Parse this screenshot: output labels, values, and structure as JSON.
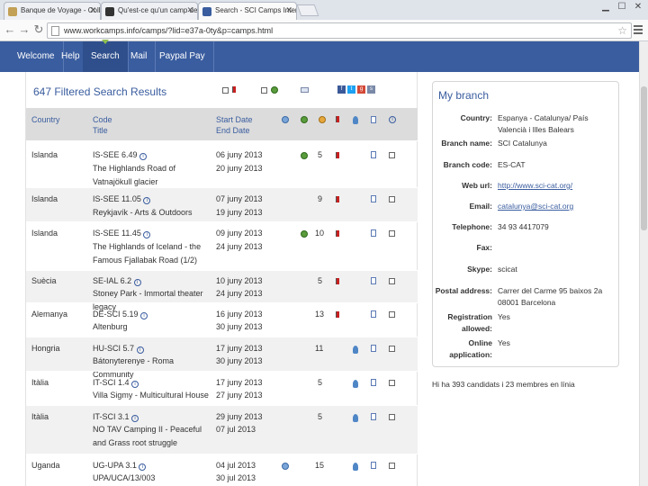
{
  "browser": {
    "tabs": [
      {
        "label": "Banque de Voyage - Collec",
        "active": false
      },
      {
        "label": "Qu'est-ce qu'un camp de volonta",
        "active": false
      },
      {
        "label": "Search - SCI Camps Internation",
        "active": true
      }
    ],
    "url": "www.workcamps.info/camps/?lid=e37a-0ty&p=camps.html"
  },
  "nav": [
    {
      "label": "Welcome"
    },
    {
      "label": "Help"
    },
    {
      "label": "Search"
    },
    {
      "label": "Mail"
    },
    {
      "label": "Paypal Pay"
    }
  ],
  "results": {
    "title": "647 Filtered Search Results",
    "columns": {
      "country": "Country",
      "code": "Code",
      "title": "Title",
      "start": "Start Date",
      "end": "End Date"
    },
    "rows": [
      {
        "country": "Islanda",
        "code": "IS-SEE 6.49",
        "title": "The Highlands Road of Vatnajökull glacier",
        "start": "06 juny 2013",
        "end": "20 juny 2013",
        "count": "5"
      },
      {
        "country": "Islanda",
        "code": "IS-SEE 11.05",
        "title": "Reykjavík - Arts & Outdoors",
        "start": "07 juny 2013",
        "end": "19 juny 2013",
        "count": "9"
      },
      {
        "country": "Islanda",
        "code": "IS-SEE 11.45",
        "title": "The Highlands of Iceland - the Famous Fjallabak Road (1/2)",
        "start": "09 juny 2013",
        "end": "24 juny 2013",
        "count": "10"
      },
      {
        "country": "Suècia",
        "code": "SE-IAL 6.2",
        "title": "Stoney Park - Immortal theater legacy",
        "start": "10 juny 2013",
        "end": "24 juny 2013",
        "count": "5"
      },
      {
        "country": "Alemanya",
        "code": "DE-SCI 5.19",
        "title": "Altenburg",
        "start": "16 juny 2013",
        "end": "30 juny 2013",
        "count": "13"
      },
      {
        "country": "Hongria",
        "code": "HU-SCI 5.7",
        "title": "Bátonyterenye - Roma Community",
        "start": "17 juny 2013",
        "end": "30 juny 2013",
        "count": "11"
      },
      {
        "country": "Itàlia",
        "code": "IT-SCI 1.4",
        "title": "Villa Sigmy - Multicultural House",
        "start": "17 juny 2013",
        "end": "27 juny 2013",
        "count": "5"
      },
      {
        "country": "Itàlia",
        "code": "IT-SCI 3.1",
        "title": "NO TAV Camping II - Peaceful and Grass root struggle",
        "start": "29 juny 2013",
        "end": "07 jul 2013",
        "count": "5"
      },
      {
        "country": "Uganda",
        "code": "UG-UPA 3.1",
        "title": "UPA/UCA/13/003",
        "start": "04 jul 2013",
        "end": "30 jul 2013",
        "count": "15"
      }
    ]
  },
  "branch": {
    "title": "My branch",
    "fields": [
      {
        "label": "Country:",
        "value": "Espanya - Catalunya/ País Valencià i Illes Balears"
      },
      {
        "label": "Branch name:",
        "value": "SCI Catalunya"
      },
      {
        "label": "Branch code:",
        "value": "ES-CAT"
      },
      {
        "label": "Web url:",
        "value": "http://www.sci-cat.org/"
      },
      {
        "label": "Email:",
        "value": "catalunya@sci-cat.org"
      },
      {
        "label": "Telephone:",
        "value": "34 93 4417079"
      },
      {
        "label": "Fax:",
        "value": ""
      },
      {
        "label": "Skype:",
        "value": "scicat"
      },
      {
        "label": "Postal address:",
        "value": "Carrer del Carme 95 baixos 2a 08001 Barcelona"
      },
      {
        "label": "Registration allowed:",
        "value": "Yes"
      },
      {
        "label": "Online application:",
        "value": "Yes"
      }
    ],
    "footnote": "Hi ha 393 candidats i 23 membres en línia"
  }
}
